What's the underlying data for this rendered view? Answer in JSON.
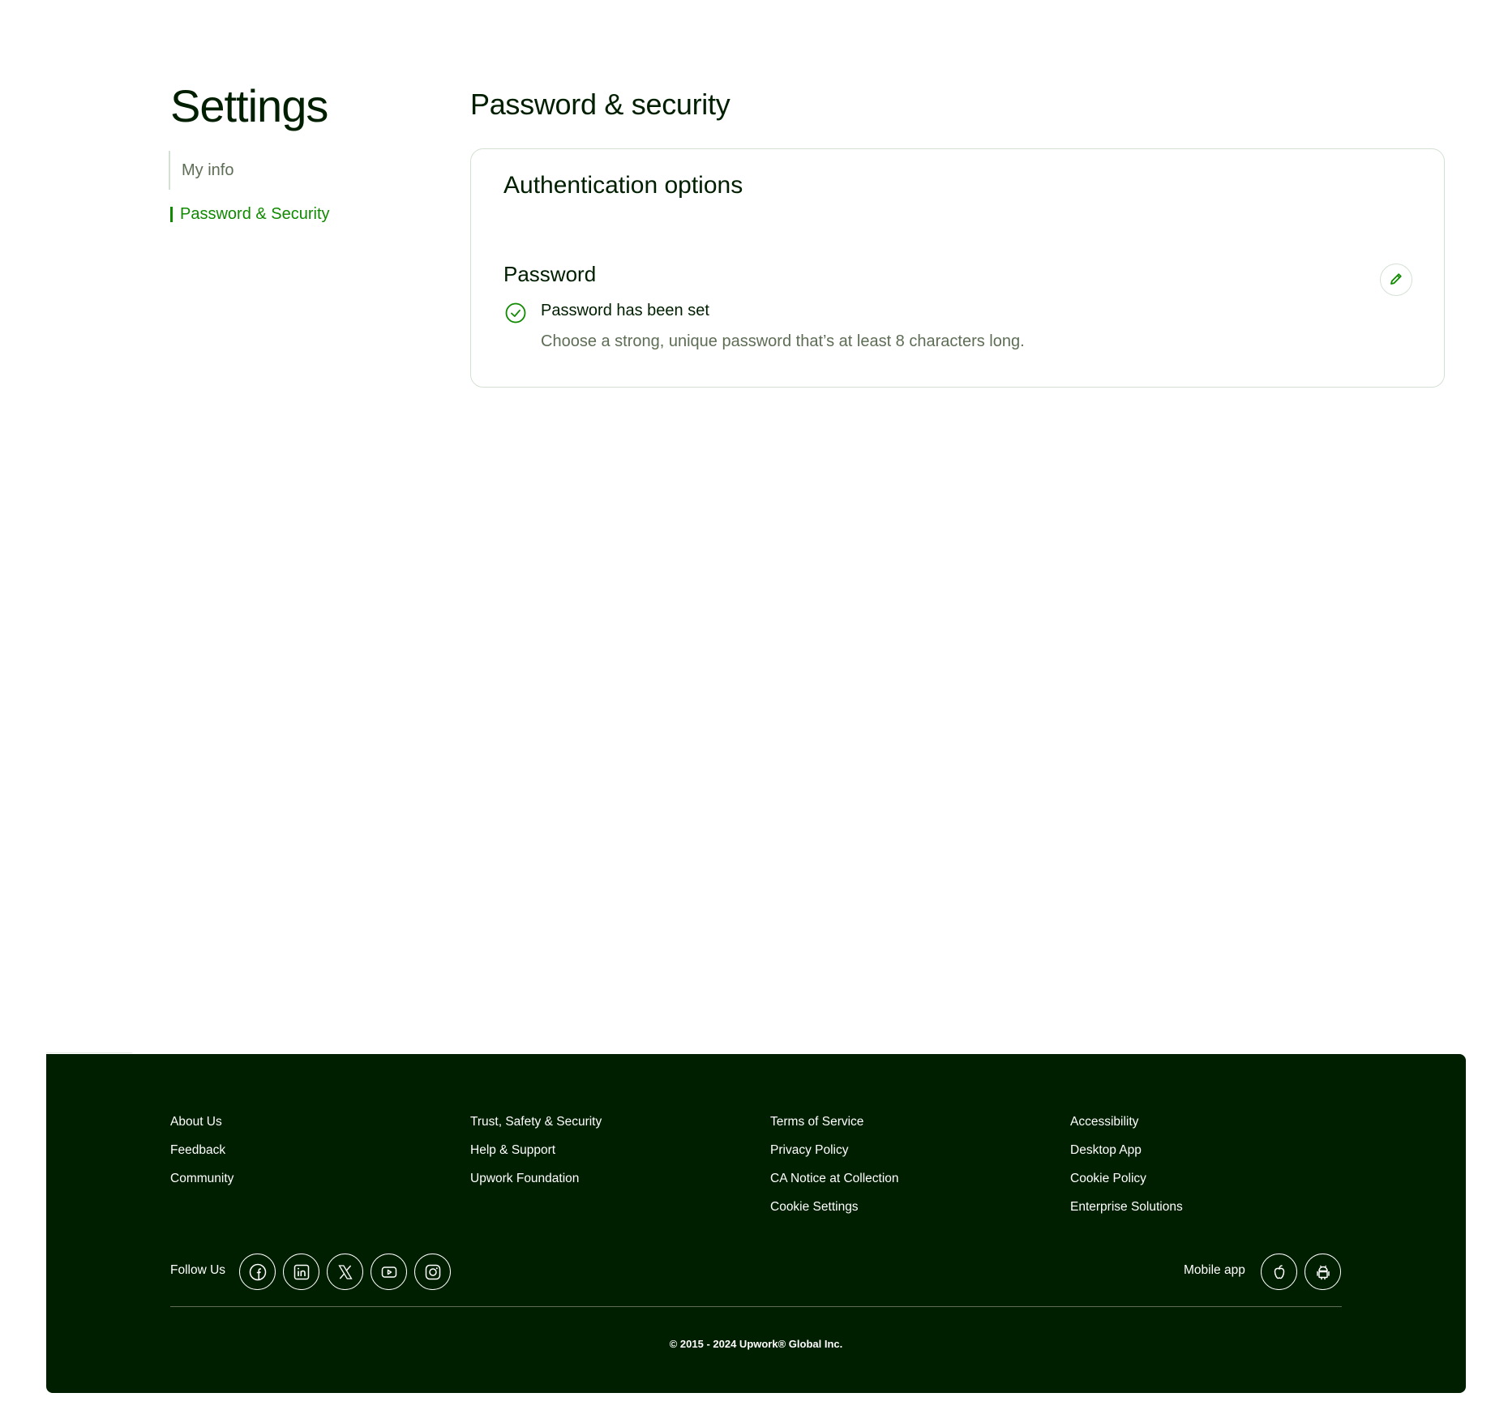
{
  "sidebar": {
    "title": "Settings",
    "items": [
      {
        "label": "My info",
        "active": false
      },
      {
        "label": "Password & Security",
        "active": true
      }
    ]
  },
  "main": {
    "section_title": "Password & security",
    "card": {
      "title": "Authentication options",
      "password": {
        "title": "Password",
        "status": "Password has been set",
        "help": "Choose a strong, unique password that’s at least 8 characters long.",
        "status_icon": "check-circle-icon",
        "edit_icon": "pencil-icon"
      }
    }
  },
  "footer": {
    "columns": [
      [
        "About Us",
        "Feedback",
        "Community"
      ],
      [
        "Trust, Safety & Security",
        "Help & Support",
        "Upwork Foundation"
      ],
      [
        "Terms of Service",
        "Privacy Policy",
        "CA Notice at Collection",
        "Cookie Settings"
      ],
      [
        "Accessibility",
        "Desktop App",
        "Cookie Policy",
        "Enterprise Solutions"
      ]
    ],
    "follow_label": "Follow Us",
    "social_icons": [
      "facebook-icon",
      "linkedin-icon",
      "x-icon",
      "youtube-icon",
      "instagram-icon"
    ],
    "mobile_label": "Mobile app",
    "mobile_icons": [
      "apple-icon",
      "android-icon"
    ],
    "copyright": "© 2015 - 2024 Upwork® Global Inc."
  },
  "colors": {
    "brand_green": "#108a00",
    "text_dark": "#001e00",
    "text_muted": "#5e6d55",
    "footer_bg": "#001e00",
    "border": "#d5e0d5"
  }
}
